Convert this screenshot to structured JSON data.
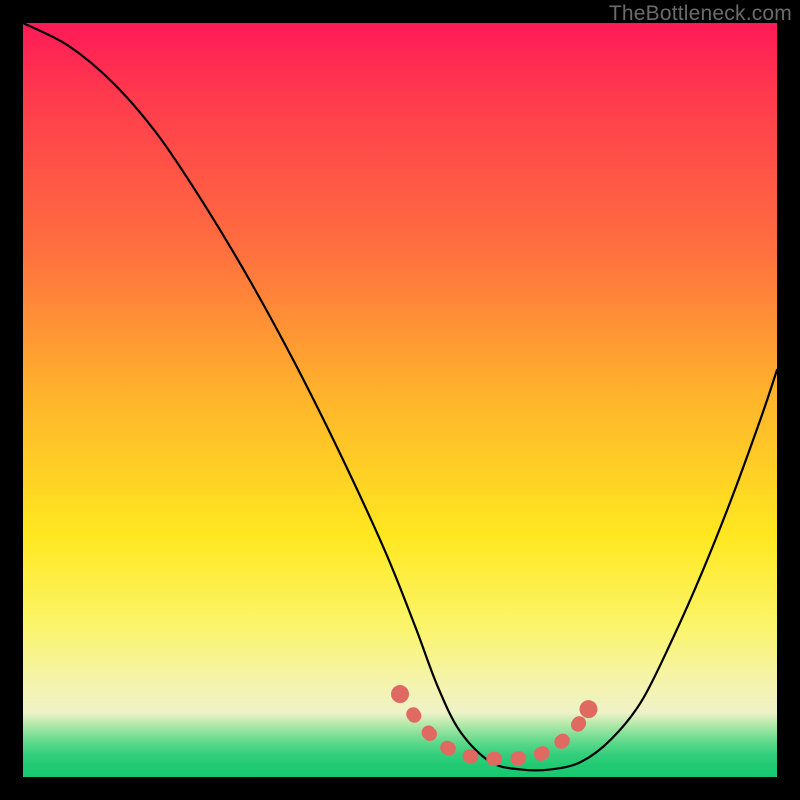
{
  "watermark": "TheBottleneck.com",
  "chart_data": {
    "type": "line",
    "title": "",
    "xlabel": "",
    "ylabel": "",
    "xlim": [
      0,
      100
    ],
    "ylim": [
      0,
      100
    ],
    "series": [
      {
        "name": "bottleneck-curve",
        "x": [
          0,
          6,
          12,
          18,
          24,
          30,
          36,
          42,
          48,
          52,
          55,
          58,
          62,
          66,
          70,
          74,
          78,
          82,
          86,
          90,
          94,
          98,
          100
        ],
        "values": [
          100,
          97,
          92,
          85,
          76,
          66,
          55,
          43,
          30,
          20,
          12,
          6,
          2,
          1,
          1,
          2,
          5,
          10,
          18,
          27,
          37,
          48,
          54
        ]
      }
    ],
    "annotations": {
      "sweet_spot_marker": {
        "x": [
          50,
          52,
          54.5,
          57,
          60,
          63,
          66,
          68.5,
          70.5,
          72,
          73.5,
          75
        ],
        "values": [
          11,
          8,
          5.2,
          3.5,
          2.6,
          2.4,
          2.5,
          3.0,
          4.0,
          5.2,
          6.8,
          9
        ]
      }
    },
    "gradient_stops": [
      {
        "pos": 0,
        "color": "#ff1a57"
      },
      {
        "pos": 0.1,
        "color": "#ff3b4d"
      },
      {
        "pos": 0.3,
        "color": "#ff6f3f"
      },
      {
        "pos": 0.5,
        "color": "#ffb52b"
      },
      {
        "pos": 0.68,
        "color": "#ffe820"
      },
      {
        "pos": 0.8,
        "color": "#fbf56a"
      },
      {
        "pos": 0.88,
        "color": "#f4f3b1"
      },
      {
        "pos": 0.915,
        "color": "#eef2c7"
      },
      {
        "pos": 0.925,
        "color": "#c8ecb3"
      },
      {
        "pos": 0.94,
        "color": "#8fe29c"
      },
      {
        "pos": 0.955,
        "color": "#5bd88a"
      },
      {
        "pos": 0.97,
        "color": "#34cf7d"
      },
      {
        "pos": 0.985,
        "color": "#20ca73"
      },
      {
        "pos": 1.0,
        "color": "#17c86f"
      }
    ]
  }
}
